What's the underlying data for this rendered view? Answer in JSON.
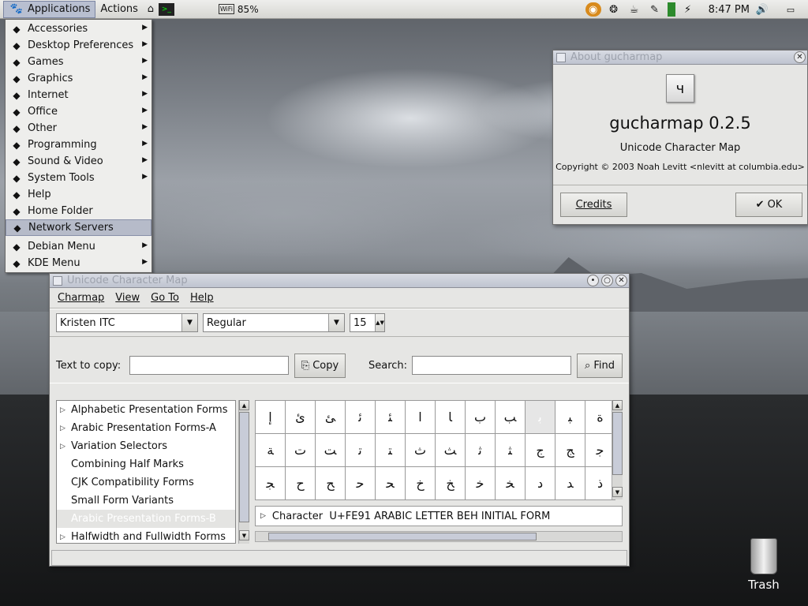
{
  "panel": {
    "applications_label": "Applications",
    "actions_label": "Actions",
    "wifi_percent": "85%",
    "clock": "8:47 PM"
  },
  "apps_menu": {
    "items": [
      {
        "label": "Accessories",
        "icon": "accessories-icon",
        "submenu": true
      },
      {
        "label": "Desktop Preferences",
        "icon": "preferences-icon",
        "submenu": true
      },
      {
        "label": "Games",
        "icon": "games-icon",
        "submenu": true
      },
      {
        "label": "Graphics",
        "icon": "graphics-icon",
        "submenu": true
      },
      {
        "label": "Internet",
        "icon": "internet-icon",
        "submenu": true
      },
      {
        "label": "Office",
        "icon": "office-icon",
        "submenu": true
      },
      {
        "label": "Other",
        "icon": "other-icon",
        "submenu": true
      },
      {
        "label": "Programming",
        "icon": "programming-icon",
        "submenu": true
      },
      {
        "label": "Sound & Video",
        "icon": "sound-video-icon",
        "submenu": true
      },
      {
        "label": "System Tools",
        "icon": "system-tools-icon",
        "submenu": true
      },
      {
        "label": "Help",
        "icon": "help-icon",
        "submenu": false
      },
      {
        "label": "Home Folder",
        "icon": "home-folder-icon",
        "submenu": false
      },
      {
        "label": "Network Servers",
        "icon": "network-servers-icon",
        "submenu": false,
        "highlighted": true
      },
      {
        "label": "Debian Menu",
        "icon": "debian-icon",
        "submenu": true
      },
      {
        "label": "KDE Menu",
        "icon": "kde-icon",
        "submenu": true
      }
    ]
  },
  "about": {
    "title": "About gucharmap",
    "app_name": "gucharmap 0.2.5",
    "description": "Unicode Character Map",
    "copyright": "Copyright © 2003 Noah Levitt <nlevitt at columbia.edu>",
    "credits_label": "Credits",
    "ok_label": "OK"
  },
  "charmap": {
    "title": "Unicode Character Map",
    "menu": [
      "Charmap",
      "View",
      "Go To",
      "Help"
    ],
    "font_family": "Kristen ITC",
    "font_style": "Regular",
    "font_size": "15",
    "text_to_copy_label": "Text to copy:",
    "copy_label": "Copy",
    "search_label": "Search:",
    "find_label": "Find",
    "blocks": [
      {
        "label": "Alphabetic Presentation Forms",
        "expander": true
      },
      {
        "label": "Arabic Presentation Forms-A",
        "expander": true
      },
      {
        "label": "Variation Selectors",
        "expander": true
      },
      {
        "label": "Combining Half Marks",
        "expander": false
      },
      {
        "label": "CJK Compatibility Forms",
        "expander": false
      },
      {
        "label": "Small Form Variants",
        "expander": false
      },
      {
        "label": "Arabic Presentation Forms-B",
        "expander": false,
        "selected": true
      },
      {
        "label": "Halfwidth and Fullwidth Forms",
        "expander": true
      }
    ],
    "glyphs": [
      [
        "ﺇ",
        "ﺉ",
        "ﺊ",
        "ﺋ",
        "ﺌ",
        "ﺍ",
        "ﺎ",
        "ﺏ",
        "ﺐ",
        "ﺑ",
        "ﺒ",
        "ﺓ"
      ],
      [
        "ﺔ",
        "ﺕ",
        "ﺖ",
        "ﺗ",
        "ﺘ",
        "ﺙ",
        "ﺚ",
        "ﺛ",
        "ﺜ",
        "ﺝ",
        "ﺞ",
        "ﺟ"
      ],
      [
        "ﺠ",
        "ﺡ",
        "ﺢ",
        "ﺣ",
        "ﺤ",
        "ﺥ",
        "ﺦ",
        "ﺧ",
        "ﺨ",
        "ﺩ",
        "ﺪ",
        "ﺫ"
      ]
    ],
    "selected_cell": [
      0,
      9
    ],
    "character_info": "Character  U+FE91 ARABIC LETTER BEH INITIAL FORM"
  },
  "desktop": {
    "trash_label": "Trash"
  }
}
